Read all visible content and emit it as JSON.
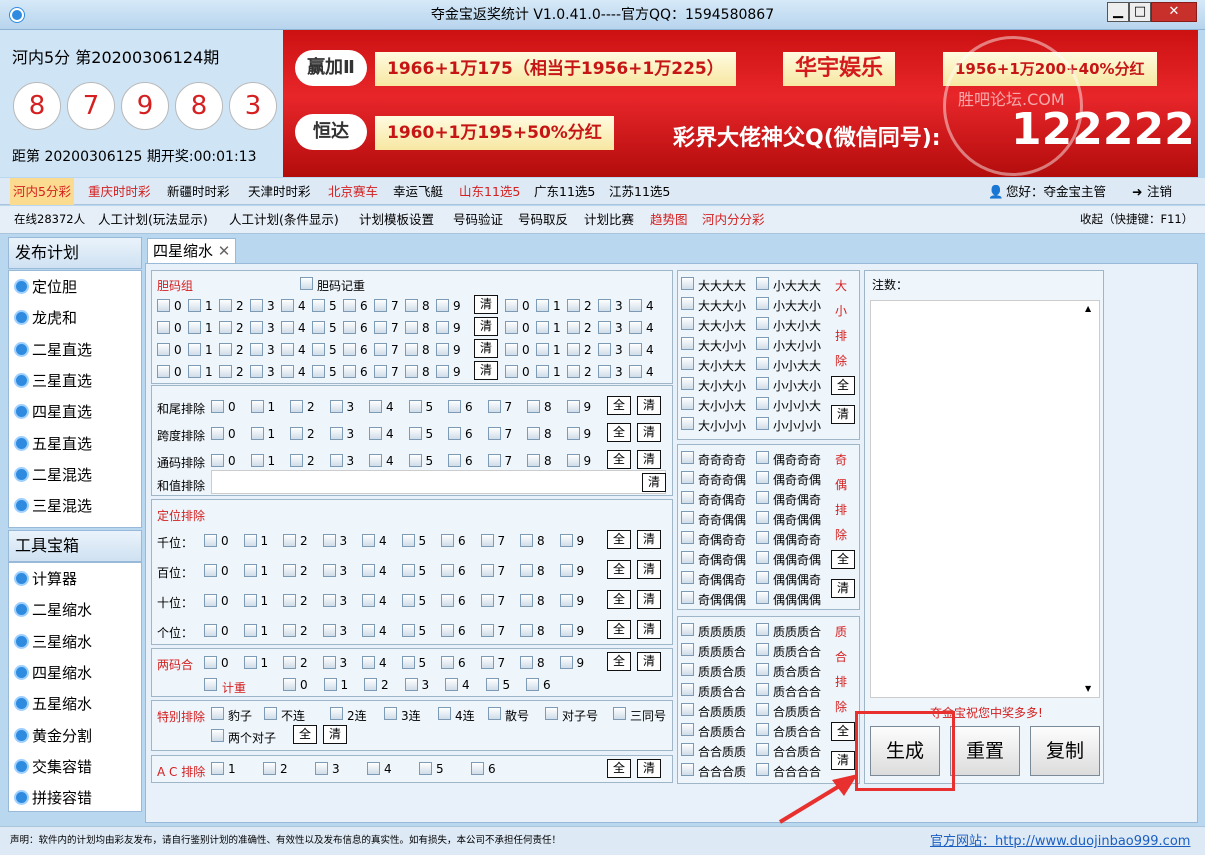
{
  "window": {
    "title": "夺金宝返奖统计  V1.0.41.0----官方QQ：1594580867",
    "minimize": "▁",
    "maximize": "□",
    "close": "✕"
  },
  "draw": {
    "period": "河内5分  第20200306124期",
    "balls": [
      "8",
      "7",
      "9",
      "8",
      "3"
    ],
    "next": "距第 20200306125 期开奖:00:01:13"
  },
  "banner": {
    "logo1": "赢加Ⅱ",
    "promo1": "1966+1万175（相当于1956+1万225）",
    "brand2": "华宇娱乐",
    "promo2": "1956+1万200+40%分红",
    "logo3": "恒达",
    "promo3": "1960+1万195+50%分红",
    "slogan": "彩界大佬神父Q(微信同号):",
    "qq": "122222",
    "watermark": "胜吧论坛.COM"
  },
  "nav1": {
    "items": [
      "河内5分彩",
      "重庆时时彩",
      "新疆时时彩",
      "天津时时彩",
      "北京赛车",
      "幸运飞艇",
      "山东11选5",
      "广东11选5",
      "江苏11选5"
    ],
    "user": "您好：夺金宝主管",
    "logout": "注销"
  },
  "nav2": {
    "online": "在线28372人",
    "items": [
      "人工计划(玩法显示)",
      "人工计划(条件显示)",
      "计划模板设置",
      "号码验证",
      "号码取反",
      "计划比赛",
      "趋势图",
      "河内分分彩"
    ],
    "collapse": "收起（快捷键：F11）"
  },
  "sidebar": {
    "plan_title": "发布计划",
    "plan": [
      "定位胆",
      "龙虎和",
      "二星直选",
      "三星直选",
      "四星直选",
      "五星直选",
      "二星混选",
      "三星混选"
    ],
    "tools_title": "工具宝箱",
    "tools": [
      "计算器",
      "二星缩水",
      "三星缩水",
      "四星缩水",
      "五星缩水",
      "黄金分割",
      "交集容错",
      "拼接容错"
    ]
  },
  "tab": {
    "label": "四星缩水",
    "close": "✕"
  },
  "form": {
    "dan_title": "胆码组",
    "dan_memo": "胆码记重",
    "all": "全",
    "clear": "清",
    "digits": [
      "0",
      "1",
      "2",
      "3",
      "4",
      "5",
      "6",
      "7",
      "8",
      "9"
    ],
    "d5": [
      "0",
      "1",
      "2",
      "3",
      "4"
    ],
    "d6": [
      "0",
      "1",
      "2",
      "3",
      "4",
      "5",
      "6"
    ],
    "tail": "和尾排除",
    "span": "跨度排除",
    "pass": "通码排除",
    "sum": "和值排除",
    "pos_title": "定位排除",
    "positions": [
      "千位：",
      "百位：",
      "十位：",
      "个位："
    ],
    "two": "两码合",
    "count": "计重",
    "special": "特别排除",
    "special_items": [
      "豹子",
      "不连",
      "2连",
      "3连",
      "4连",
      "散号",
      "对子号",
      "三同号"
    ],
    "two_pair": "两个对子",
    "ac": "A C 排除",
    "ac_items": [
      "1",
      "2",
      "3",
      "4",
      "5",
      "6"
    ]
  },
  "mid": {
    "bs_left": [
      "大大大大",
      "大大大小",
      "大大小大",
      "大大小小",
      "大小大大",
      "大小大小",
      "大小小大",
      "大小小小"
    ],
    "bs_right": [
      "小大大大",
      "小大大小",
      "小大小大",
      "小大小小",
      "小小大大",
      "小小大小",
      "小小小大",
      "小小小小"
    ],
    "bs_side": [
      "大",
      "小",
      "排",
      "除"
    ],
    "oe_left": [
      "奇奇奇奇",
      "奇奇奇偶",
      "奇奇偶奇",
      "奇奇偶偶",
      "奇偶奇奇",
      "奇偶奇偶",
      "奇偶偶奇",
      "奇偶偶偶"
    ],
    "oe_right": [
      "偶奇奇奇",
      "偶奇奇偶",
      "偶奇偶奇",
      "偶奇偶偶",
      "偶偶奇奇",
      "偶偶奇偶",
      "偶偶偶奇",
      "偶偶偶偶"
    ],
    "oe_side": [
      "奇",
      "偶",
      "排",
      "除"
    ],
    "pc_left": [
      "质质质质",
      "质质质合",
      "质质合质",
      "质质合合",
      "合质质质",
      "合质质合",
      "合合质质",
      "合合合质"
    ],
    "pc_right": [
      "质质质合",
      "质质合合",
      "质合质合",
      "质合合合",
      "合质质合",
      "合质合合",
      "合合质合",
      "合合合合"
    ],
    "pc_side": [
      "质",
      "合",
      "排",
      "除"
    ]
  },
  "right": {
    "notes": "注数：",
    "wish": "夺金宝祝您中奖多多!",
    "generate": "生成",
    "reset": "重置",
    "copy": "复制"
  },
  "status": {
    "disclaimer": "声明：软件内的计划均由彩友发布，请自行鉴别计划的准确性、有效性以及发布信息的真实性。如有损失，本公司不承担任何责任！",
    "site": "官方网站：http://www.duojinbao999.com"
  },
  "colors": {
    "accent_red": "#d42020",
    "annotation": "#e8312f"
  }
}
